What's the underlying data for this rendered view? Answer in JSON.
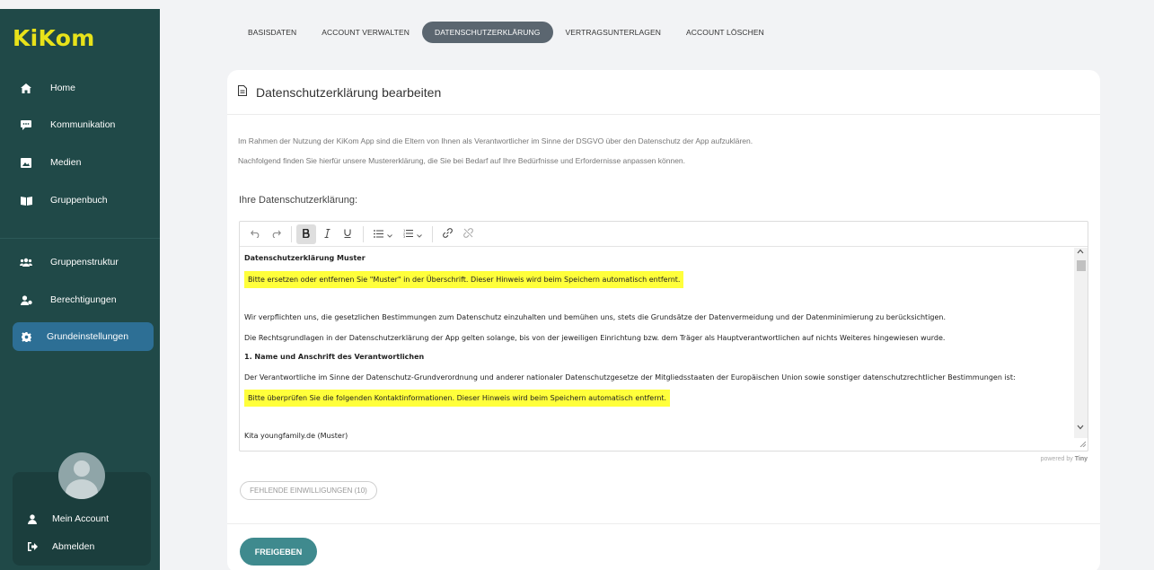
{
  "app": {
    "logo": "KiKom"
  },
  "sidebar": {
    "items": [
      {
        "label": "Home",
        "icon": "home-icon"
      },
      {
        "label": "Kommunikation",
        "icon": "chat-icon"
      },
      {
        "label": "Medien",
        "icon": "image-icon"
      },
      {
        "label": "Gruppenbuch",
        "icon": "book-icon"
      },
      {
        "label": "Gruppenstruktur",
        "icon": "group-icon"
      },
      {
        "label": "Berechtigungen",
        "icon": "user-permission-icon"
      },
      {
        "label": "Grundeinstellungen",
        "icon": "gear-icon",
        "active": true
      }
    ],
    "account": {
      "my_account": "Mein Account",
      "logout": "Abmelden"
    }
  },
  "tabs": [
    {
      "label": "BASISDATEN"
    },
    {
      "label": "ACCOUNT VERWALTEN"
    },
    {
      "label": "DATENSCHUTZERKLÄRUNG",
      "active": true
    },
    {
      "label": "VERTRAGSUNTERLAGEN"
    },
    {
      "label": "ACCOUNT LÖSCHEN"
    }
  ],
  "card": {
    "title": "Datenschutzerklärung bearbeiten",
    "intro_1": "Im Rahmen der Nutzung der KiKom App sind die Eltern von Ihnen als Verantwortlicher im Sinne der DSGVO über den Datenschutz der App aufzuklären.",
    "intro_2": "Nachfolgend finden Sie hierfür unsere Mustererklärung, die Sie bei Bedarf auf Ihre Bedürfnisse und Erfordernisse anpassen können.",
    "section_label": "Ihre Datenschutzerklärung:",
    "editor": {
      "heading": "Datenschutzerklärung Muster",
      "highlight_1": "Bitte ersetzen oder entfernen Sie \"Muster\" in der Überschrift. Dieser Hinweis wird beim Speichern automatisch entfernt.",
      "para_1": "Wir verpflichten uns, die gesetzlichen Bestimmungen zum Datenschutz einzuhalten und bemühen uns, stets die Grundsätze der Datenvermeidung und der Datenminimierung zu berücksichtigen.",
      "para_2": "Die Rechtsgrundlagen in der Datenschutzerklärung der App gelten solange, bis von der jeweiligen Einrichtung bzw. dem Träger als Hauptverantwortlichen auf nichts Weiteres hingewiesen wurde.",
      "section_1": "1. Name und Anschrift des Verantwortlichen",
      "para_3": "Der Verantwortliche im Sinne der Datenschutz-Grundverordnung und anderer nationaler Datenschutzgesetze der Mitgliedsstaaten der Europäischen Union sowie sonstiger datenschutzrechtlicher Bestimmungen ist:",
      "highlight_2": "Bitte überprüfen Sie die folgenden Kontaktinformationen. Dieser Hinweis wird beim Speichern automatisch entfernt.",
      "partial_line": "Kita youngfamily.de (Muster)"
    },
    "powered_by": "powered by",
    "powered_brand": "Tiny",
    "missing_consents": "FEHLENDE EINWILLIGUNGEN (10)",
    "submit": "FREIGEBEN"
  }
}
